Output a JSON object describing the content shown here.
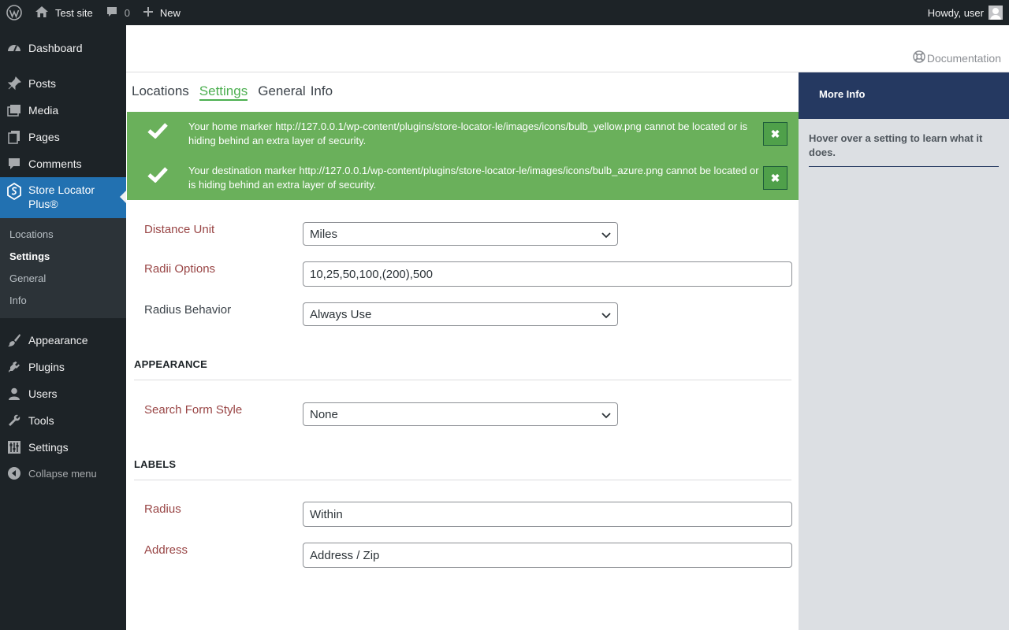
{
  "adminbar": {
    "site_name": "Test site",
    "comments_count": "0",
    "new_label": "New",
    "howdy": "Howdy, user"
  },
  "sidebar": {
    "items": [
      {
        "label": "Dashboard",
        "icon": "dashboard-icon"
      },
      {
        "label": "Posts",
        "icon": "pin-icon"
      },
      {
        "label": "Media",
        "icon": "media-icon"
      },
      {
        "label": "Pages",
        "icon": "pages-icon"
      },
      {
        "label": "Comments",
        "icon": "comment-icon"
      },
      {
        "label": "Store Locator Plus®",
        "icon": "store-locator-icon"
      },
      {
        "label": "Appearance",
        "icon": "brush-icon"
      },
      {
        "label": "Plugins",
        "icon": "plug-icon"
      },
      {
        "label": "Users",
        "icon": "user-icon"
      },
      {
        "label": "Tools",
        "icon": "wrench-icon"
      },
      {
        "label": "Settings",
        "icon": "settings-icon"
      }
    ],
    "submenu": [
      "Locations",
      "Settings",
      "General",
      "Info"
    ],
    "collapse_label": "Collapse menu"
  },
  "header": {
    "documentation_label": "Documentation"
  },
  "tabs": [
    "Locations",
    "Settings",
    "General",
    "Info"
  ],
  "notices": [
    "Your home marker http://127.0.0.1/wp-content/plugins/store-locator-le/images/icons/bulb_yellow.png cannot be located or is hiding behind an extra layer of security.",
    "Your destination marker http://127.0.0.1/wp-content/plugins/store-locator-le/images/icons/bulb_azure.png cannot be located or is hiding behind an extra layer of security."
  ],
  "form": {
    "distance_unit": {
      "label": "Distance Unit",
      "value": "Miles"
    },
    "radii_options": {
      "label": "Radii Options",
      "value": "10,25,50,100,(200),500"
    },
    "radius_behavior": {
      "label": "Radius Behavior",
      "value": "Always Use"
    },
    "appearance_heading": "APPEARANCE",
    "search_form_style": {
      "label": "Search Form Style",
      "value": "None"
    },
    "labels_heading": "LABELS",
    "radius": {
      "label": "Radius",
      "value": "Within"
    },
    "address": {
      "label": "Address",
      "value": "Address / Zip"
    }
  },
  "panel": {
    "title": "More Info",
    "body": "Hover over a setting to learn what it does."
  },
  "colors": {
    "admin_dark": "#1d2327",
    "accent_blue": "#2271b1",
    "notice_green": "#6ab05b",
    "tab_active_green": "#4caf50",
    "label_red": "#994545",
    "panel_navy": "#253961"
  }
}
